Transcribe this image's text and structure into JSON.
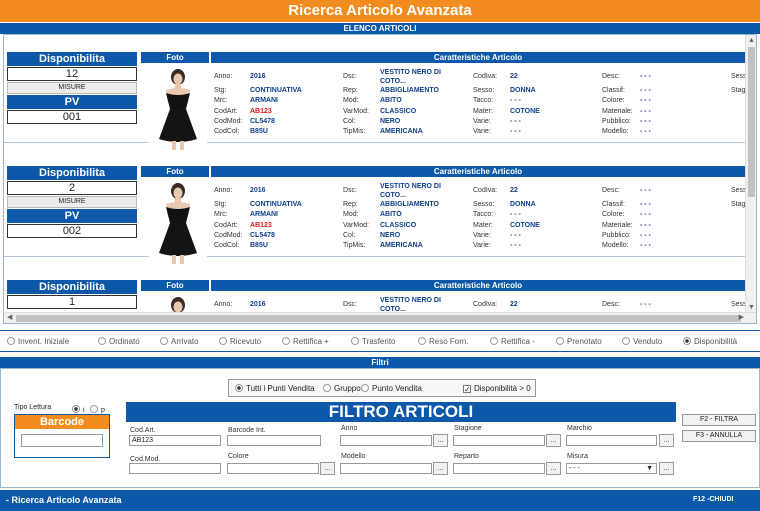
{
  "header": {
    "title": "Ricerca Articolo Avanzata",
    "list_title": "ELENCO ARTICOLI"
  },
  "cards": [
    {
      "disp_label": "Disponibilita",
      "disp_value": "12",
      "misure": "MISURE",
      "pv_label": "PV",
      "pv_value": "001",
      "foto_label": "Foto",
      "car_label": "Caratteristiche Articolo",
      "anno_l": "Anno:",
      "anno": "2016",
      "stg_l": "Stg:",
      "stg": "CONTINUATIVA",
      "mrc_l": "Mrc:",
      "mrc": "ARMANI",
      "codart_l": "CodArt:",
      "codart": "AB123",
      "codmod_l": "CodMod:",
      "codmod": "CL5478",
      "codcol_l": "CodCol:",
      "codcol": "B85U",
      "dsc_l": "Dsc:",
      "dsc": "VESTITO NERO DI COTO...",
      "rep_l": "Rep:",
      "rep": "ABBIGLIAMENTO",
      "mod_l": "Mod:",
      "mod": "ABITO",
      "varmod_l": "VarMod:",
      "varmod": "CLASSICO",
      "col_l": "Col:",
      "col": "NERO",
      "tipmis_l": "TipMis:",
      "tipmis": "AMERICANA",
      "codiva_l": "CodIva:",
      "codiva": "22",
      "sesso_l": "Sesso:",
      "sesso": "DONNA",
      "tacco_l": "Tacco:",
      "tacco": "- - -",
      "mater_l": "Mater:",
      "mater": "COTONE",
      "varie1_l": "Varie:",
      "varie1": "- - -",
      "varie2_l": "Varie:",
      "varie2": "- - -",
      "desc_l": "Desc:",
      "desc": "- - -",
      "classif_l": "Classif:",
      "classif": "- - -",
      "colore_l": "Colore:",
      "colore": "- - -",
      "materiale_l": "Materiale:",
      "materiale": "- - -",
      "pubblico_l": "Pubblico:",
      "pubblico": "- - -",
      "modello_l": "Modello:",
      "modello": "- - -",
      "sess_l": "Sess",
      "stagi_l": "Stagi"
    },
    {
      "disp_label": "Disponibilita",
      "disp_value": "2",
      "misure": "MISURE",
      "pv_label": "PV",
      "pv_value": "002",
      "foto_label": "Foto",
      "car_label": "Caratteristiche Articolo",
      "anno_l": "Anno:",
      "anno": "2016",
      "stg_l": "Stg:",
      "stg": "CONTINUATIVA",
      "mrc_l": "Mrc:",
      "mrc": "ARMANI",
      "codart_l": "CodArt:",
      "codart": "AB123",
      "codmod_l": "CodMod:",
      "codmod": "CL5478",
      "codcol_l": "CodCol:",
      "codcol": "B85U",
      "dsc_l": "Dsc:",
      "dsc": "VESTITO NERO DI COTO...",
      "rep_l": "Rep:",
      "rep": "ABBIGLIAMENTO",
      "mod_l": "Mod:",
      "mod": "ABITO",
      "varmod_l": "VarMod:",
      "varmod": "CLASSICO",
      "col_l": "Col:",
      "col": "NERO",
      "tipmis_l": "TipMis:",
      "tipmis": "AMERICANA",
      "codiva_l": "CodIva:",
      "codiva": "22",
      "sesso_l": "Sesso:",
      "sesso": "DONNA",
      "tacco_l": "Tacco:",
      "tacco": "- - -",
      "mater_l": "Mater:",
      "mater": "COTONE",
      "varie1_l": "Varie:",
      "varie1": "- - -",
      "varie2_l": "Varie:",
      "varie2": "- - -",
      "desc_l": "Desc:",
      "desc": "- - -",
      "classif_l": "Classif:",
      "classif": "- - -",
      "colore_l": "Colore:",
      "colore": "- - -",
      "materiale_l": "Materiale:",
      "materiale": "- - -",
      "pubblico_l": "Pubblico:",
      "pubblico": "- - -",
      "modello_l": "Modello:",
      "modello": "- - -",
      "sess_l": "Sess",
      "stagi_l": "Stagi"
    },
    {
      "disp_label": "Disponibilita",
      "disp_value": "1",
      "foto_label": "Foto",
      "car_label": "Caratteristiche Articolo",
      "anno_l": "Anno:",
      "anno": "2016",
      "dsc_l": "Dsc:",
      "dsc": "VESTITO NERO DI COTO...",
      "codiva_l": "CodIva:",
      "codiva": "22",
      "desc_l": "Desc:",
      "desc": "- - -",
      "sess_l": "Sess"
    }
  ],
  "radios": [
    {
      "label": "Invent. Iniziale",
      "checked": false
    },
    {
      "label": "Ordinato",
      "checked": false
    },
    {
      "label": "Arrivato",
      "checked": false
    },
    {
      "label": "Ricevuto",
      "checked": false
    },
    {
      "label": "Rettifica +",
      "checked": false
    },
    {
      "label": "Trasferito",
      "checked": false
    },
    {
      "label": "Reso Forn.",
      "checked": false
    },
    {
      "label": "Rettifica -",
      "checked": false
    },
    {
      "label": "Prenotato",
      "checked": false
    },
    {
      "label": "Venduto",
      "checked": false
    },
    {
      "label": "Disponibilità",
      "checked": true
    }
  ],
  "filtri": {
    "title": "Filtri",
    "pv_opts": [
      "Tutti i Punti Vendita",
      "Gruppo",
      "Punto Vendita"
    ],
    "disp_check": "Disponibilità > 0",
    "tipo_lettura": "Tipo Lettura",
    "tipo_i": "i",
    "tipo_p": "p",
    "barcode_label": "Barcode",
    "filtro_title": "FILTRO ARTICOLI",
    "fields": {
      "codart_l": "Cod.Art.",
      "codart_v": "AB123",
      "barcode_int_l": "Barcode Int.",
      "anno_l": "Anno",
      "stagione_l": "Stagione",
      "marchio_l": "Marchio",
      "codmod_l": "Cod.Mod.",
      "colore_l": "Colore",
      "modello_l": "Modello",
      "reparto_l": "Reparto",
      "misura_l": "Misura",
      "misura_v": "- - -",
      "dots": "..."
    },
    "btn_filtra": "F2 - FILTRA",
    "btn_annulla": "F3 - ANNULLA"
  },
  "footer": {
    "title": "- Ricerca Articolo Avanzata",
    "close": "F12 -CHIUDI"
  }
}
